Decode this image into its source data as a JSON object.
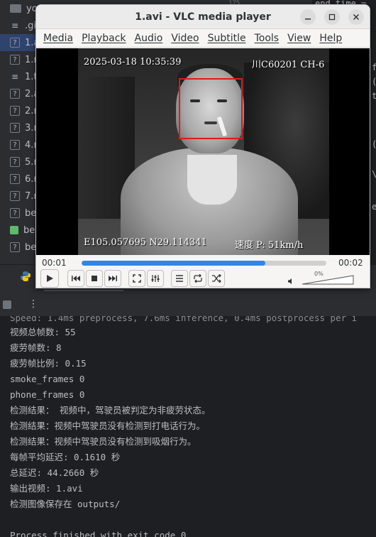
{
  "project_tree": {
    "items": [
      {
        "label": "yo",
        "icon": "folder-icon"
      },
      {
        "label": ".gi",
        "icon": "lines-icon"
      },
      {
        "label": "1.a",
        "icon": "unknown-file-icon",
        "selected": true
      },
      {
        "label": "1.n",
        "icon": "unknown-file-icon"
      },
      {
        "label": "1.t",
        "icon": "lines-icon"
      },
      {
        "label": "2.a",
        "icon": "unknown-file-icon"
      },
      {
        "label": "2.n",
        "icon": "unknown-file-icon"
      },
      {
        "label": "3.n",
        "icon": "unknown-file-icon"
      },
      {
        "label": "4.n",
        "icon": "unknown-file-icon"
      },
      {
        "label": "5.n",
        "icon": "unknown-file-icon"
      },
      {
        "label": "6.n",
        "icon": "unknown-file-icon"
      },
      {
        "label": "7.n",
        "icon": "unknown-file-icon"
      },
      {
        "label": "be",
        "icon": "unknown-file-icon"
      },
      {
        "label": "be",
        "icon": "green-file-icon"
      },
      {
        "label": "be",
        "icon": "unknown-file-icon"
      }
    ]
  },
  "code_fragments": {
    "line_number": "175",
    "top_text": "end_time =",
    "right_chars": [
      "f",
      "(",
      "t",
      "(",
      "\\",
      "e"
    ]
  },
  "vlc": {
    "title": "1.avi - VLC media player",
    "menu": [
      "Media",
      "Playback",
      "Audio",
      "Video",
      "Subtitle",
      "Tools",
      "View",
      "Help"
    ],
    "osd": {
      "timestamp": "2025-03-18 10:35:39",
      "channel": "川C60201 CH-6",
      "gps": "E105.057695 N29.114341",
      "speed": "速度 P: 51km/h"
    },
    "elapsed": "00:01",
    "duration": "00:02",
    "progress": 0.75,
    "volume_label": "0%",
    "buttons": {
      "play": "play-icon",
      "prev": "previous-icon",
      "stop": "stop-icon",
      "next": "next-icon",
      "fullscreen": "fullscreen-icon",
      "extended": "equalizer-icon",
      "playlist": "playlist-icon",
      "loop": "loop-icon",
      "random": "shuffle-icon"
    }
  },
  "console": {
    "cut_line": "Speed: 1.4ms preprocess, 7.6ms inference, 0.4ms postprocess per i",
    "lines": [
      "视频总帧数: 55",
      "疲劳帧数: 8",
      "疲劳帧比例: 0.15",
      "smoke_frames 0",
      "phone_frames 0",
      "检测结果：  视频中，驾驶员被判定为非疲劳状态。",
      "检测结果：视频中驾驶员没有检测到打电话行为。",
      "检测结果：视频中驾驶员没有检测到吸烟行为。",
      "每帧平均延迟: 0.1610 秒",
      "总延迟: 44.2660 秒",
      "输出视频: 1.avi",
      "检测图像保存在 outputs/"
    ],
    "exit_line": "Process finished with exit code 0"
  }
}
